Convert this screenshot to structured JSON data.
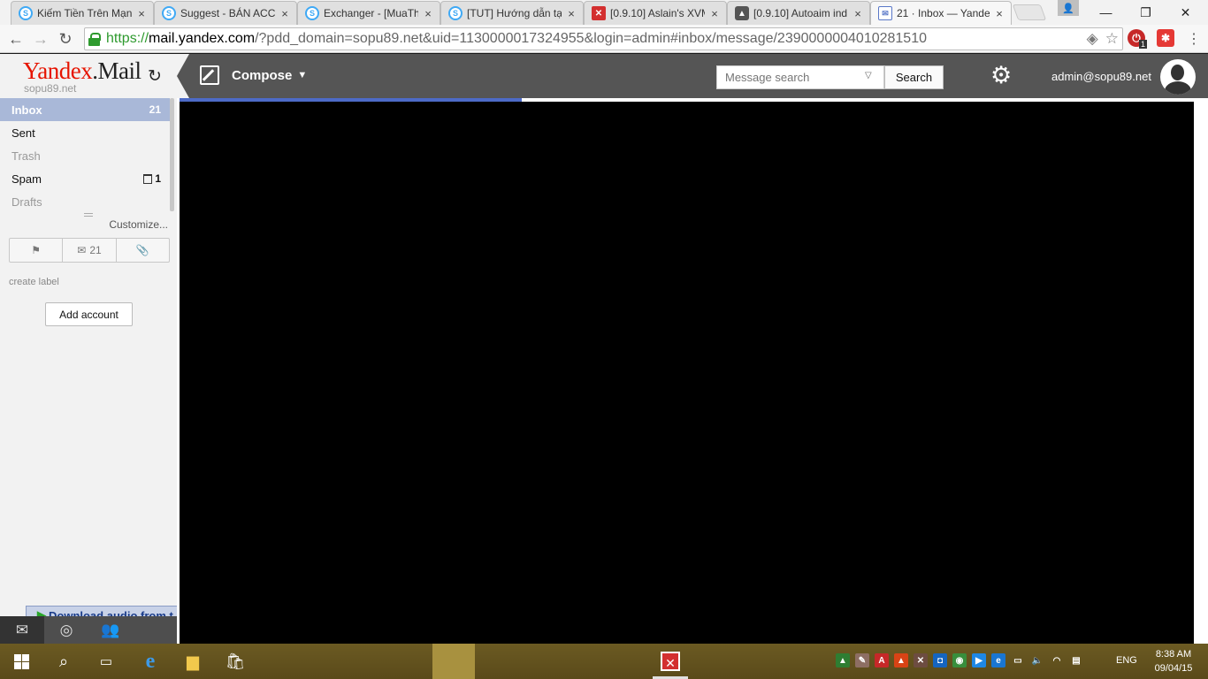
{
  "browser": {
    "tabs": [
      {
        "title": "Kiếm Tiền Trên Mạng",
        "icon": "skype-s-icon"
      },
      {
        "title": "Suggest - BÁN ACC",
        "icon": "skype-s-icon"
      },
      {
        "title": "Exchanger - [MuaThe",
        "icon": "skype-s-icon"
      },
      {
        "title": "[TUT] Hướng dẫn tạo",
        "icon": "skype-s-icon"
      },
      {
        "title": "[0.9.10] Aslain's XVM",
        "icon": "x-box-icon"
      },
      {
        "title": "[0.9.10] Autoaim ind",
        "icon": "tank-icon"
      },
      {
        "title": "21 · Inbox — Yandex",
        "icon": "mail-envelope-icon"
      }
    ],
    "url_scheme": "https://",
    "url_host": "mail.yandex.com",
    "url_rest": "/?pdd_domain=sopu89.net&uid=1130000017324955&login=admin#inbox/message/2390000004010281510",
    "extension_badge": "1"
  },
  "app": {
    "logo_brand": "Yandex",
    "logo_dot": ".",
    "logo_product": "Mail",
    "domain": "sopu89.net",
    "compose_label": "Compose",
    "search_placeholder": "Message search",
    "search_button": "Search",
    "user_email": "admin@sopu89.net",
    "accent_color": "#4d6bc7"
  },
  "sidebar": {
    "folders": [
      {
        "label": "Inbox",
        "count": "21",
        "active": true
      },
      {
        "label": "Sent",
        "count": ""
      },
      {
        "label": "Trash",
        "count": ""
      },
      {
        "label": "Spam",
        "count": "1"
      },
      {
        "label": "Drafts",
        "count": ""
      }
    ],
    "customize_label": "Customize...",
    "filter_unread_count": "21",
    "create_label": "create label",
    "add_account": "Add account",
    "download_banner": "Download audio from t"
  },
  "taskbar": {
    "language": "ENG",
    "time": "8:38 AM",
    "date": "09/04/15"
  }
}
